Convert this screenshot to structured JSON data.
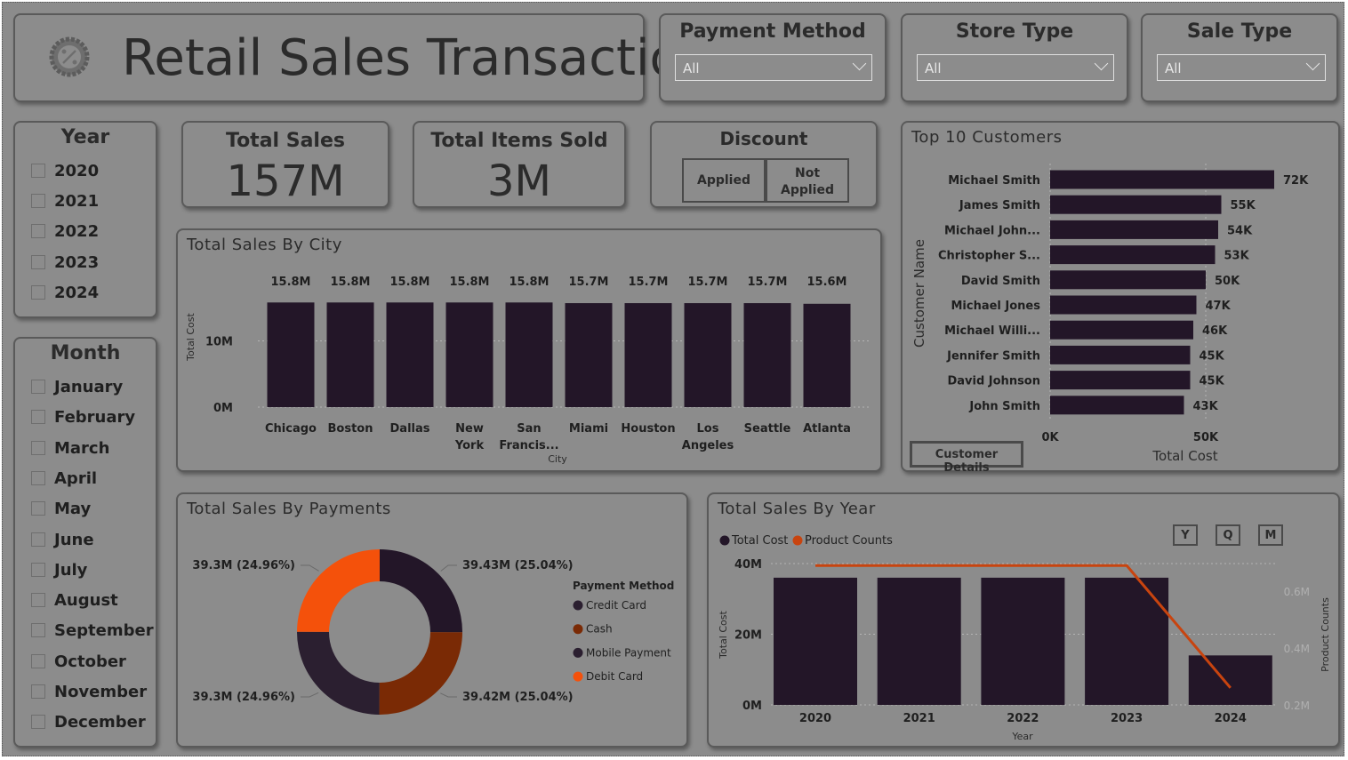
{
  "header": {
    "title": "Retail Sales Transaction",
    "logo_icon": "discount-badge-icon"
  },
  "filters": {
    "payment_method": {
      "label": "Payment Method",
      "value": "All"
    },
    "store_type": {
      "label": "Store Type",
      "value": "All"
    },
    "sale_type": {
      "label": "Sale Type",
      "value": "All"
    }
  },
  "year_slicer": {
    "title": "Year",
    "items": [
      "2020",
      "2021",
      "2022",
      "2023",
      "2024"
    ]
  },
  "month_slicer": {
    "title": "Month",
    "items": [
      "January",
      "February",
      "March",
      "April",
      "May",
      "June",
      "July",
      "August",
      "September",
      "October",
      "November",
      "December"
    ]
  },
  "kpis": {
    "total_sales": {
      "label": "Total Sales",
      "value": "157M"
    },
    "total_items": {
      "label": "Total Items Sold",
      "value": "3M"
    }
  },
  "discount": {
    "title": "Discount",
    "applied": "Applied",
    "not_applied_1": "Not",
    "not_applied_2": "Applied"
  },
  "customer_details_button": "Customer Details",
  "time_buttons": [
    "Y",
    "Q",
    "M"
  ],
  "colors": {
    "bar": "#231628",
    "line": "#c8440f",
    "orange": "#f4510b",
    "brown": "#7a2a05",
    "dark_purple": "#2b1f30"
  },
  "chart_data": [
    {
      "type": "bar",
      "title": "Total Sales By City",
      "categories": [
        "Chicago",
        "Boston",
        "Dallas",
        "New York",
        "San Francis...",
        "Miami",
        "Houston",
        "Los Angeles",
        "Seattle",
        "Atlanta"
      ],
      "values": [
        15.8,
        15.8,
        15.8,
        15.8,
        15.8,
        15.7,
        15.7,
        15.7,
        15.7,
        15.6
      ],
      "data_labels": [
        "15.8M",
        "15.8M",
        "15.8M",
        "15.8M",
        "15.8M",
        "15.7M",
        "15.7M",
        "15.7M",
        "15.7M",
        "15.6M"
      ],
      "xlabel": "City",
      "ylabel": "Total Cost",
      "yticks": [
        "0M",
        "10M"
      ],
      "ylim": [
        0,
        20
      ]
    },
    {
      "type": "bar",
      "orientation": "horizontal",
      "title": "Top 10 Customers",
      "categories": [
        "Michael Smith",
        "James Smith",
        "Michael John...",
        "Christopher S...",
        "David Smith",
        "Michael Jones",
        "Michael Willi...",
        "Jennifer Smith",
        "David Johnson",
        "John Smith"
      ],
      "values": [
        72,
        55,
        54,
        53,
        50,
        47,
        46,
        45,
        45,
        43
      ],
      "data_labels": [
        "72K",
        "55K",
        "54K",
        "53K",
        "50K",
        "47K",
        "46K",
        "45K",
        "45K",
        "43K"
      ],
      "xlabel": "Total Cost",
      "ylabel": "Customer Name",
      "xticks": [
        "0K",
        "50K"
      ],
      "xlim": [
        0,
        80
      ]
    },
    {
      "type": "pie",
      "donut": true,
      "title": "Total Sales By Payments",
      "legend_title": "Payment Method",
      "legend": [
        "Credit Card",
        "Cash",
        "Mobile Payment",
        "Debit Card"
      ],
      "legend_colors": [
        "#2b1f30",
        "#7a2a05",
        "#2b1f30",
        "#f4510b"
      ],
      "slices": [
        {
          "name": "Credit Card",
          "value": 39.43,
          "label": "39.43M (25.04%)",
          "color": "#231628"
        },
        {
          "name": "Cash",
          "value": 39.42,
          "label": "39.42M (25.04%)",
          "color": "#7a2a05"
        },
        {
          "name": "Mobile Payment",
          "value": 39.3,
          "label": "39.3M (24.96%)",
          "color": "#2b1f30"
        },
        {
          "name": "Debit Card",
          "value": 39.3,
          "label": "39.3M (24.96%)",
          "color": "#f4510b"
        }
      ]
    },
    {
      "type": "bar",
      "combo": "bar+line",
      "title": "Total Sales By Year",
      "categories": [
        "2020",
        "2021",
        "2022",
        "2023",
        "2024"
      ],
      "series": [
        {
          "name": "Total Cost",
          "values": [
            36,
            36,
            36,
            36,
            14
          ],
          "axis": "left"
        },
        {
          "name": "Product Counts",
          "values": [
            0.69,
            0.69,
            0.69,
            0.69,
            0.26
          ],
          "axis": "right",
          "type": "line"
        }
      ],
      "xlabel": "Year",
      "ylabel": "Total Cost",
      "y2label": "Product Counts",
      "yticks": [
        "0M",
        "20M",
        "40M"
      ],
      "ylim": [
        0,
        40
      ],
      "y2ticks": [
        "0.2M",
        "0.4M",
        "0.6M"
      ],
      "y2lim": [
        0.2,
        0.7
      ]
    }
  ]
}
